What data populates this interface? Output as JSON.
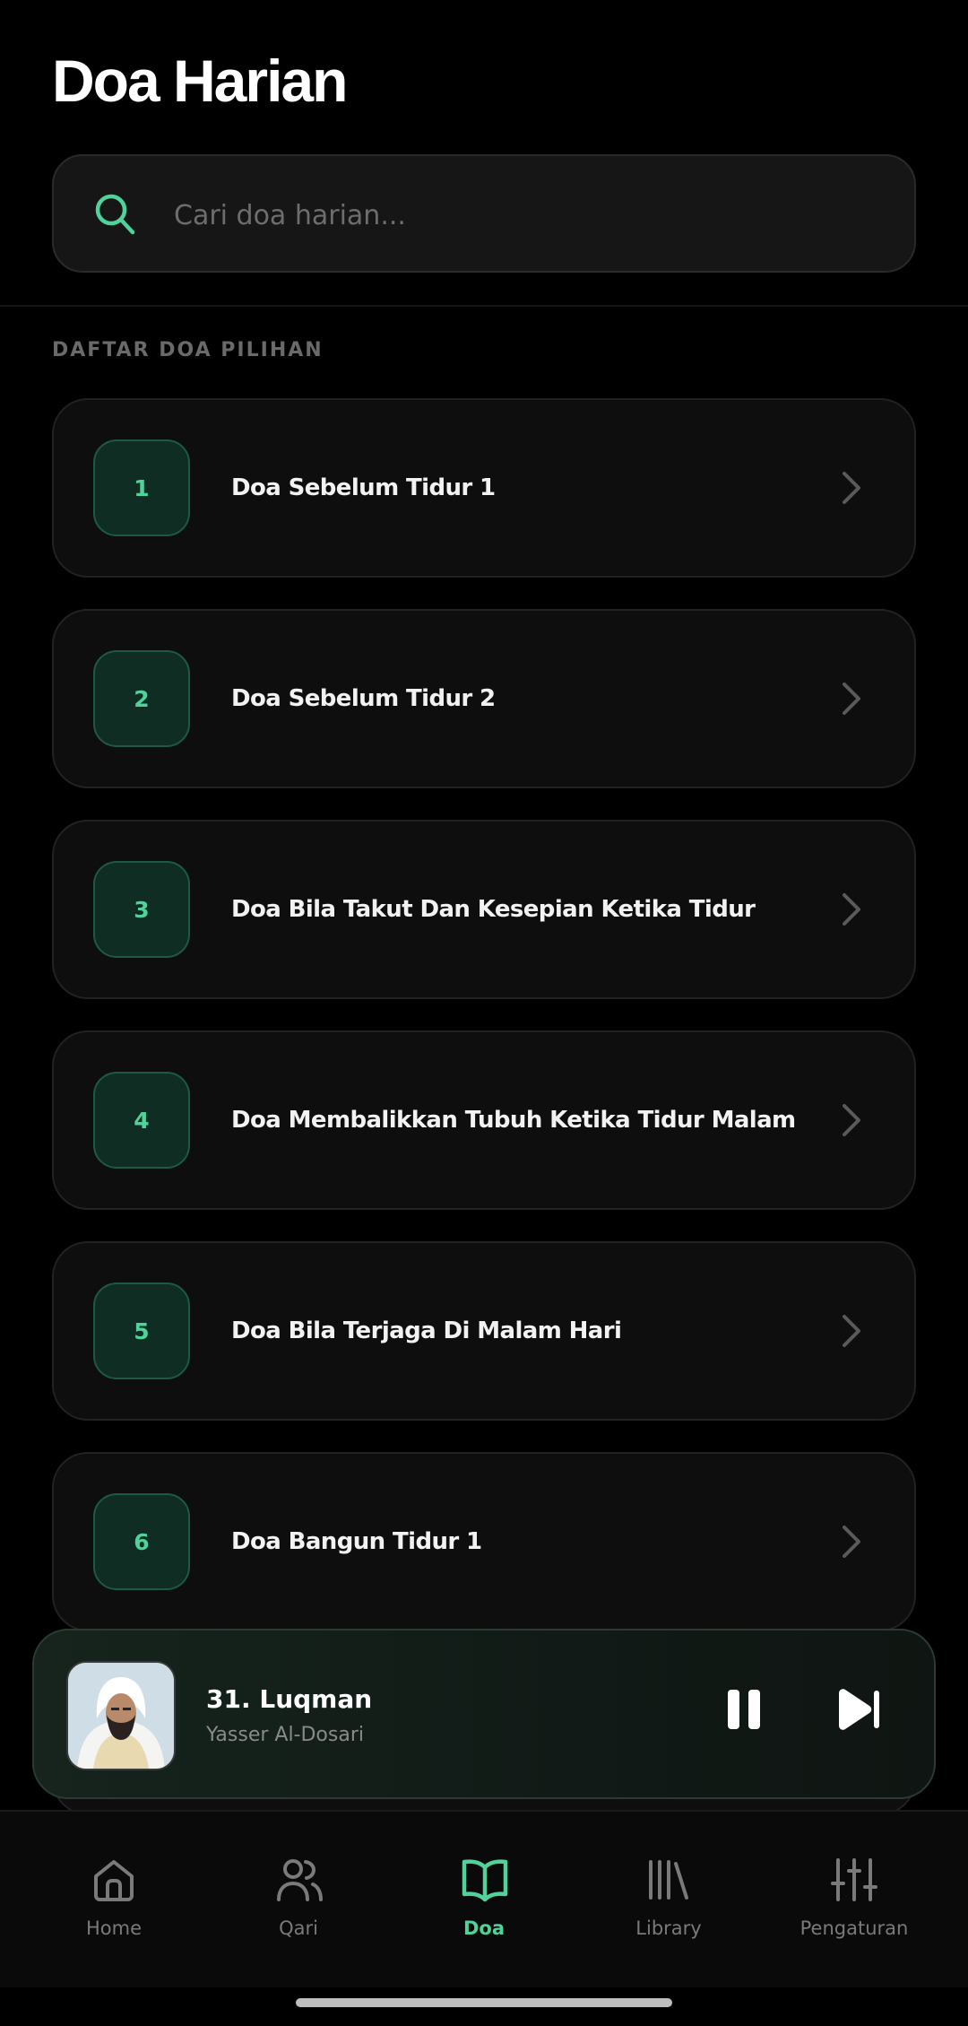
{
  "header": {
    "title": "Doa Harian"
  },
  "search": {
    "placeholder": "Cari doa harian...",
    "value": "",
    "icon": "search-icon"
  },
  "section": {
    "label": "DAFTAR DOA PILIHAN"
  },
  "doa_list": [
    {
      "number": "1",
      "title": "Doa Sebelum Tidur 1"
    },
    {
      "number": "2",
      "title": "Doa Sebelum Tidur 2"
    },
    {
      "number": "3",
      "title": "Doa Bila Takut Dan Kesepian Ketika Tidur"
    },
    {
      "number": "4",
      "title": "Doa Membalikkan Tubuh Ketika Tidur Malam"
    },
    {
      "number": "5",
      "title": "Doa Bila Terjaga Di Malam Hari"
    },
    {
      "number": "6",
      "title": "Doa Bangun Tidur 1"
    }
  ],
  "player": {
    "title": "31. Luqman",
    "artist": "Yasser Al-Dosari",
    "state": "playing",
    "controls": [
      "pause-icon",
      "skip-next-icon"
    ]
  },
  "nav": {
    "items": [
      {
        "label": "Home",
        "icon": "home-icon",
        "active": false
      },
      {
        "label": "Qari",
        "icon": "users-icon",
        "active": false
      },
      {
        "label": "Doa",
        "icon": "book-open-icon",
        "active": true
      },
      {
        "label": "Library",
        "icon": "library-icon",
        "active": false
      },
      {
        "label": "Pengaturan",
        "icon": "sliders-icon",
        "active": false
      }
    ]
  },
  "colors": {
    "background": "#000000",
    "accent": "#4fd39a",
    "card": "#0e0e0e",
    "muted_text": "#6a6a6a"
  }
}
